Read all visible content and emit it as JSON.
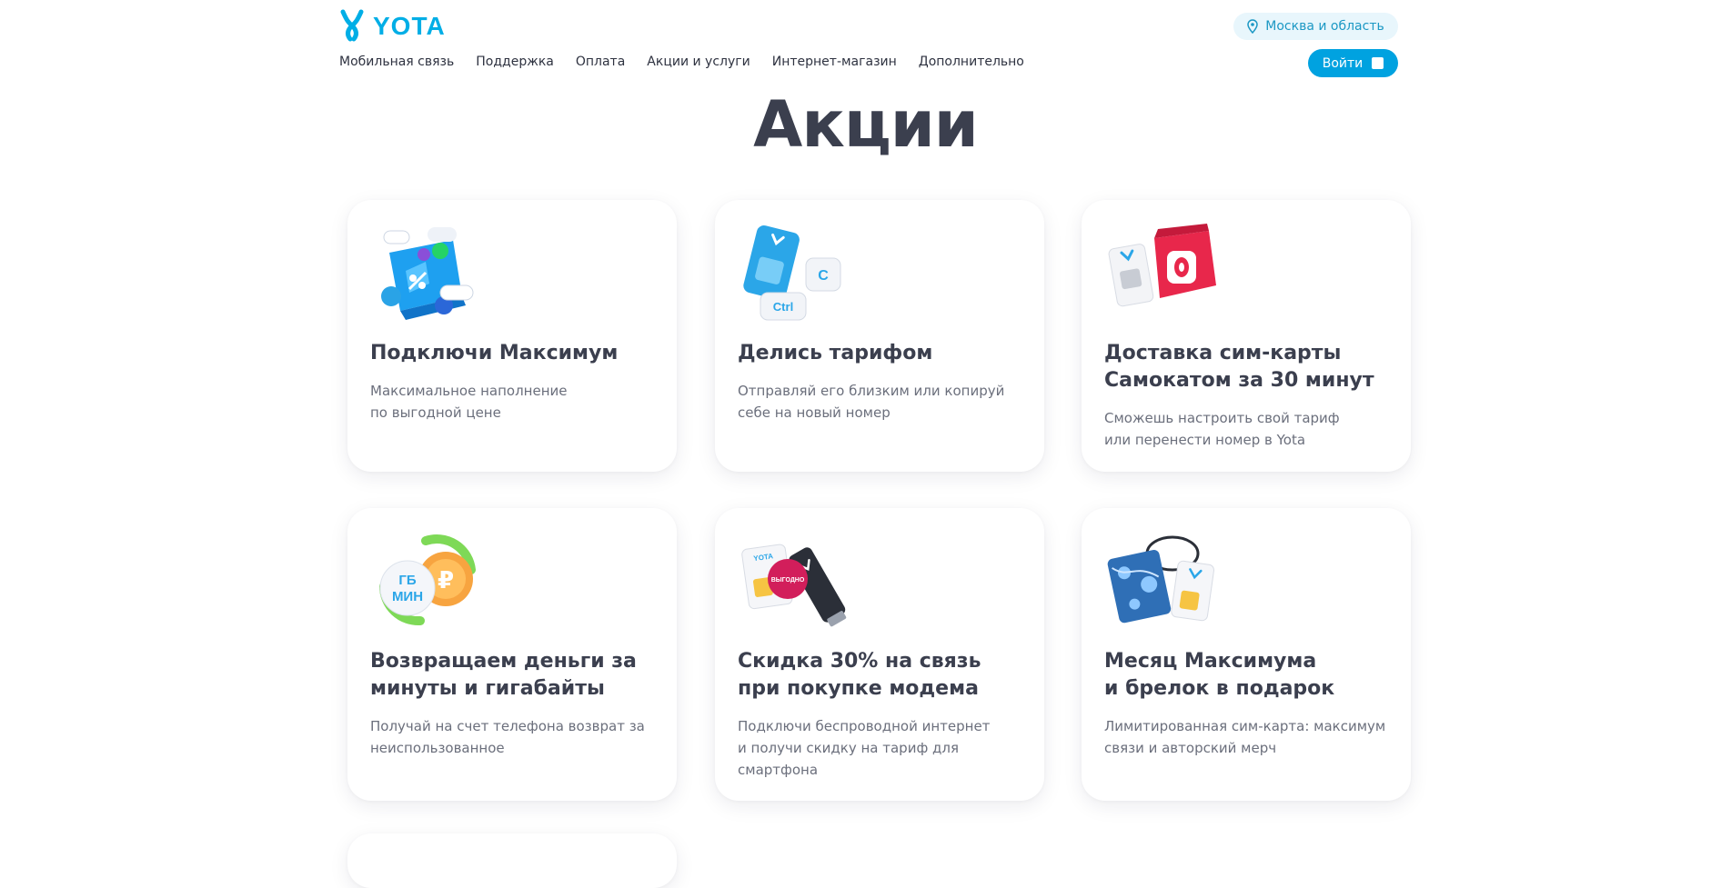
{
  "header": {
    "logo_text": "YOTA",
    "region_label": "Москва и область",
    "login_label": "Войти",
    "nav": [
      "Мобильная связь",
      "Поддержка",
      "Оплата",
      "Акции и услуги",
      "Интернет-магазин",
      "Дополнительно"
    ]
  },
  "page_title": "Акции",
  "cards": [
    {
      "title_lines": [
        "Подключи Максимум"
      ],
      "text_lines": [
        "Максимальное наполнение",
        "по выгодной цене"
      ],
      "image_icon": "shopping-box-illustration-icon"
    },
    {
      "title_lines": [
        "Делись тарифом"
      ],
      "text_lines": [
        "Отправляй его близким или копируй",
        "себе на новый номер"
      ],
      "image_icon": "sim-card-copy-illustration-icon"
    },
    {
      "title_lines": [
        "Доставка сим-карты",
        "Самокатом за 30 минут"
      ],
      "text_lines": [
        "Сможешь настроить свой тариф",
        "или перенести номер в Yota"
      ],
      "image_icon": "delivery-bag-illustration-icon"
    },
    {
      "title_lines": [
        "Возвращаем деньги за",
        "минуты и гигабайты"
      ],
      "text_lines": [
        "Получай на счет телефона возврат за",
        "неиспользованное"
      ],
      "image_icon": "cashback-coin-illustration-icon",
      "image_text": [
        "ГБ",
        "МИН"
      ]
    },
    {
      "title_lines": [
        "Скидка 30% на связь",
        "при покупке модема"
      ],
      "text_lines": [
        "Подключи беспроводной интернет",
        "и получи скидку на тариф для",
        "смартфона"
      ],
      "image_icon": "modem-illustration-icon",
      "image_text": [
        "YOTA",
        "ВЫГОДНО"
      ]
    },
    {
      "title_lines": [
        "Месяц Максимума",
        "и брелок в подарок"
      ],
      "text_lines": [
        "Лимитированная сим-карта: максимум",
        "связи и авторский мерч"
      ],
      "image_icon": "keychain-illustration-icon"
    }
  ],
  "colors": {
    "accent": "#00a2e0",
    "title": "#3b3f4e",
    "text": "#6b6f7c"
  }
}
